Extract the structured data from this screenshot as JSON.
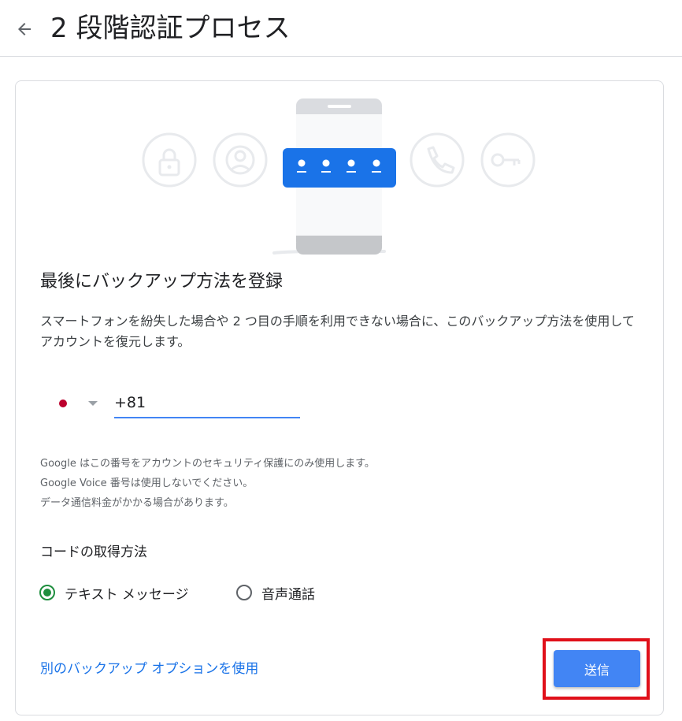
{
  "header": {
    "title": "2 段階認証プロセス",
    "back_icon": "arrow-left-icon"
  },
  "illustration": {
    "icons": [
      "lock-icon",
      "account-icon",
      "phone-call-icon",
      "key-icon"
    ],
    "code_placeholder": "••••",
    "colors": {
      "accent": "#1a73e8",
      "icon_gray": "#dadce0"
    }
  },
  "content": {
    "heading": "最後にバックアップ方法を登録",
    "description": "スマートフォンを紛失した場合や 2 つ目の手順を利用できない場合に、このバックアップ方法を使用してアカウントを復元します。"
  },
  "phone": {
    "country_flag": "japan-flag-icon",
    "value": "+81"
  },
  "notes": [
    "Google はこの番号をアカウントのセキュリティ保護にのみ使用します。",
    "Google Voice 番号は使用しないでください。",
    "データ通信料金がかかる場合があります。"
  ],
  "method": {
    "title": "コードの取得方法",
    "options": [
      {
        "label": "テキスト メッセージ",
        "selected": true
      },
      {
        "label": "音声通話",
        "selected": false
      }
    ]
  },
  "actions": {
    "alt_link": "別のバックアップ オプションを使用",
    "send": "送信"
  },
  "colors": {
    "primary_button": "#4285f4",
    "link": "#1a73e8",
    "radio_selected": "#1e8e3e",
    "highlight_border": "#e0101a",
    "flag_red": "#bc002d"
  }
}
